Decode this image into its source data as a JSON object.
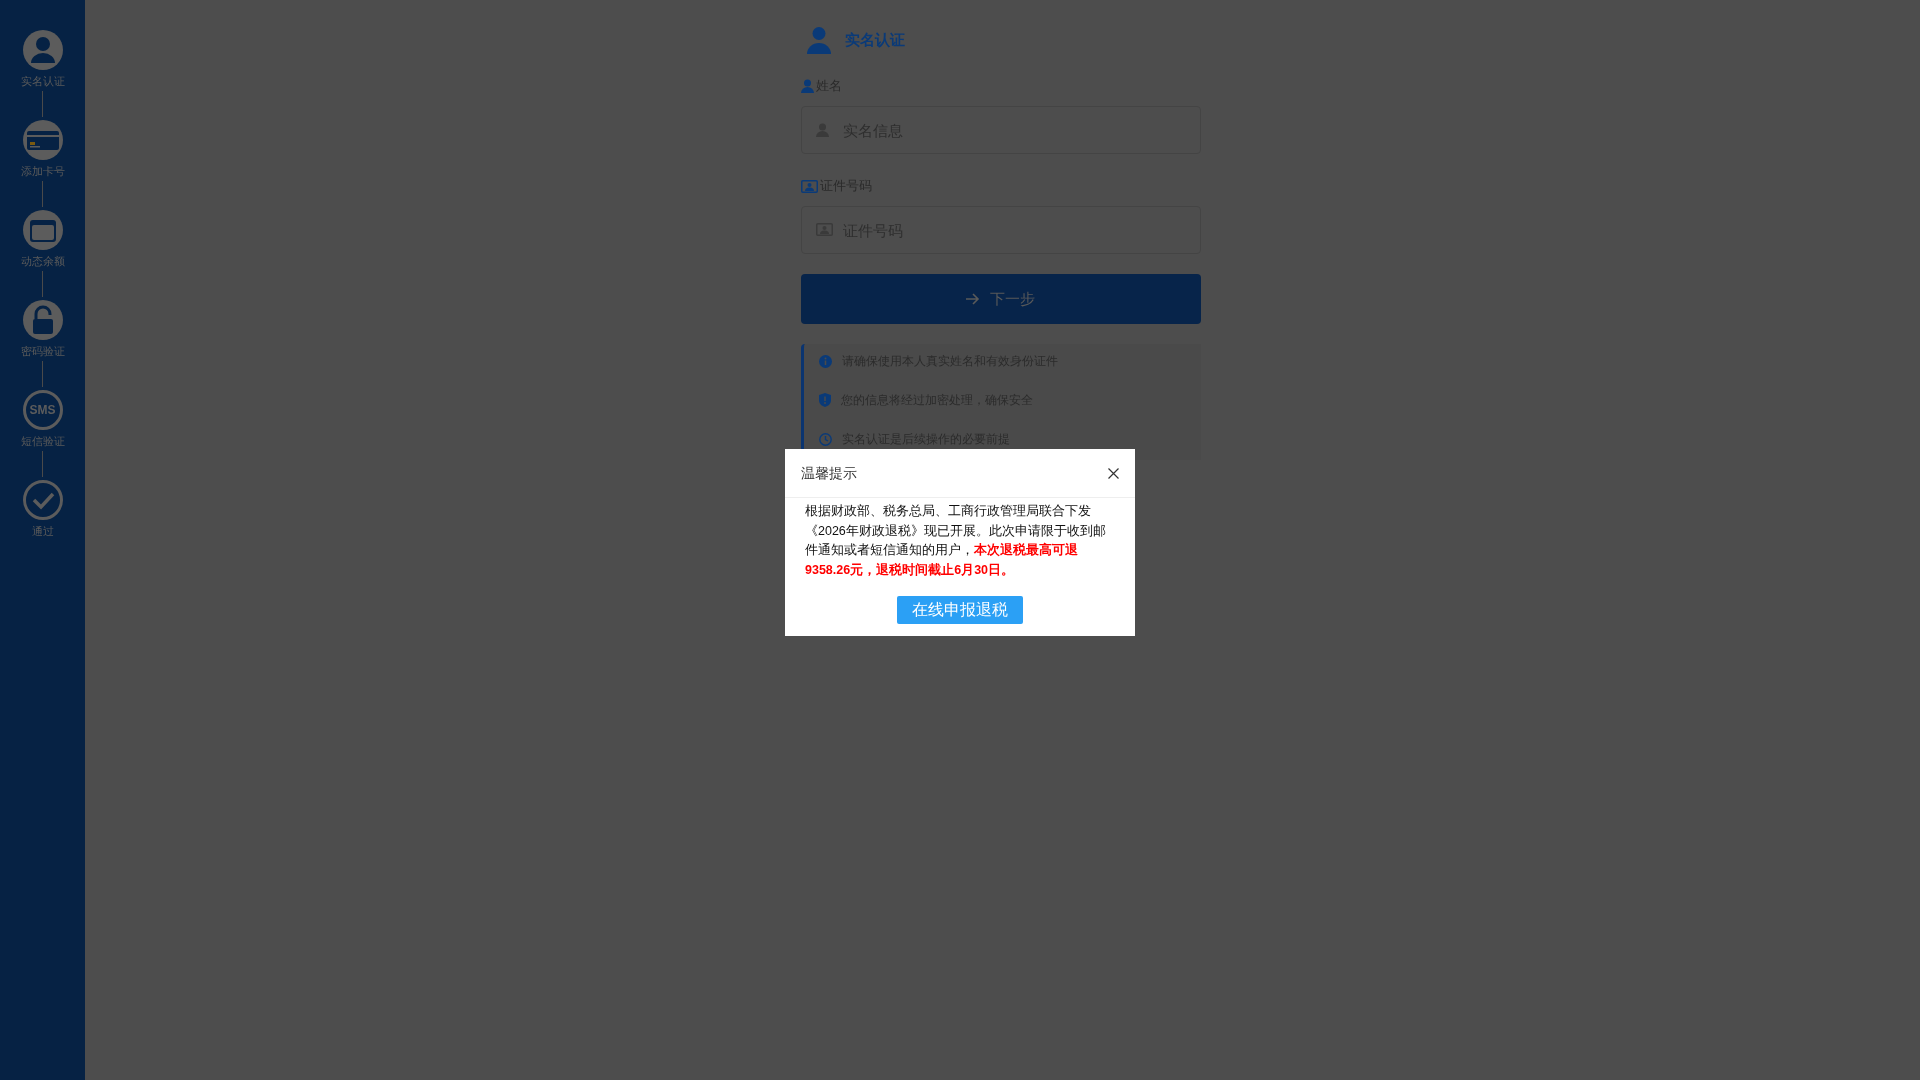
{
  "sidebar": {
    "steps": [
      {
        "kind": "user",
        "label": "实名认证"
      },
      {
        "kind": "card",
        "label": "添加卡号"
      },
      {
        "kind": "wallet",
        "label": "动态余额"
      },
      {
        "kind": "lock",
        "label": "密码验证"
      },
      {
        "kind": "sms",
        "icon_text": "SMS",
        "label": "短信验证"
      },
      {
        "kind": "check",
        "label": "通过"
      }
    ]
  },
  "form": {
    "title": "实名认证",
    "fields": [
      {
        "kind": "person",
        "label": "姓名",
        "placeholder": "实名信息"
      },
      {
        "kind": "id",
        "label": "证件号码",
        "placeholder": "证件号码"
      }
    ],
    "submit": "下一步",
    "tips": [
      {
        "kind": "info",
        "text": "请确保使用本人真实姓名和有效身份证件"
      },
      {
        "kind": "shield",
        "text": "您的信息将经过加密处理，确保安全"
      },
      {
        "kind": "clock",
        "text": "实名认证是后续操作的必要前提"
      }
    ]
  },
  "dialog": {
    "title": "温馨提示",
    "message": "根据财政部、税务总局、工商行政管理局联合下发《2026年财政退税》现已开展。此次申请限于收到邮件通知或者短信通知的用户，",
    "highlight": "本次退税最高可退9358.26元，退税时间截止6月30日。",
    "button": "在线申报退税"
  }
}
